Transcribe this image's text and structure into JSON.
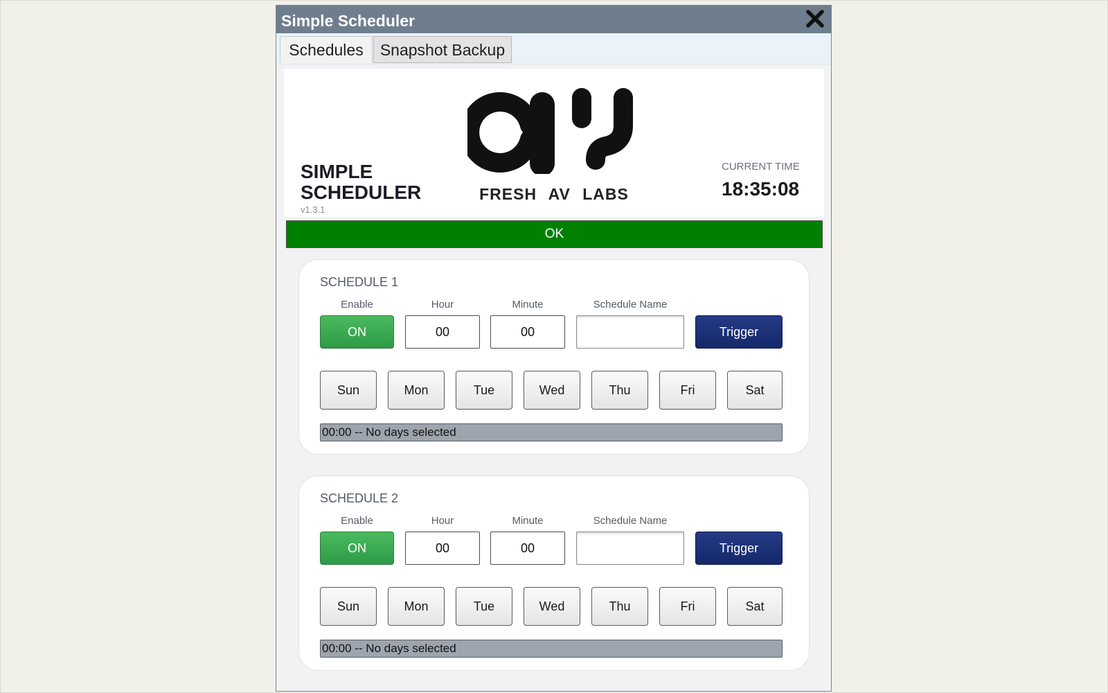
{
  "window": {
    "title": "Simple Scheduler",
    "close_icon": "close-x-icon"
  },
  "tabs": [
    {
      "label": "Schedules",
      "active": true
    },
    {
      "label": "Snapshot Backup",
      "active": false
    }
  ],
  "header": {
    "app_name_line1": "SIMPLE",
    "app_name_line2": "SCHEDULER",
    "version": "v1.3.1",
    "logo_icon": "fresh-av-labs-logo",
    "brand": "FRESH AV LABS",
    "time_label": "CURRENT TIME",
    "time_value": "18:35:08"
  },
  "status": {
    "text": "OK",
    "color": "#008000"
  },
  "labels": {
    "enable": "Enable",
    "hour": "Hour",
    "minute": "Minute",
    "schedule_name": "Schedule Name",
    "trigger": "Trigger"
  },
  "days": [
    "Sun",
    "Mon",
    "Tue",
    "Wed",
    "Thu",
    "Fri",
    "Sat"
  ],
  "schedules": [
    {
      "title": "SCHEDULE 1",
      "enable_label": "ON",
      "hour": "00",
      "minute": "00",
      "name": "",
      "summary": "00:00 -- No days selected"
    },
    {
      "title": "SCHEDULE 2",
      "enable_label": "ON",
      "hour": "00",
      "minute": "00",
      "name": "",
      "summary": "00:00 -- No days selected"
    }
  ],
  "colors": {
    "on_green": "#3aab52",
    "trigger_navy": "#1d3178",
    "titlebar": "#6f7e8f"
  }
}
